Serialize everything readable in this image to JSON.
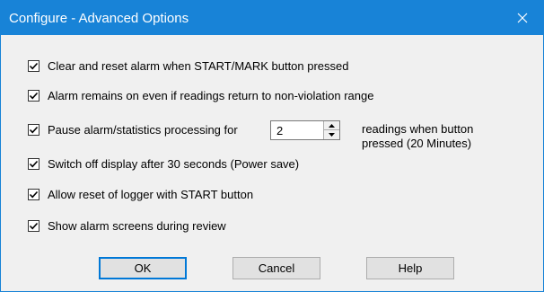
{
  "window": {
    "title": "Configure - Advanced Options",
    "close_icon": "close-icon"
  },
  "colors": {
    "titlebar": "#1883d7",
    "dialog_bg": "#f0f0f0",
    "button_bg": "#e1e1e1",
    "default_border": "#0078d7"
  },
  "options": [
    {
      "label": "Clear and reset alarm when START/MARK button pressed",
      "checked": true
    },
    {
      "label": "Alarm remains on even if readings return to non-violation range",
      "checked": true
    },
    {
      "label": "Pause alarm/statistics processing for",
      "checked": true
    },
    {
      "label": "Switch off display after 30 seconds (Power save)",
      "checked": true
    },
    {
      "label": "Allow reset of logger with START button",
      "checked": true
    },
    {
      "label": "Show alarm screens during review",
      "checked": true
    }
  ],
  "pause": {
    "value": "2",
    "suffix_line1": "readings when button",
    "suffix_line2": "pressed (20 Minutes)"
  },
  "buttons": {
    "ok": "OK",
    "cancel": "Cancel",
    "help": "Help"
  }
}
